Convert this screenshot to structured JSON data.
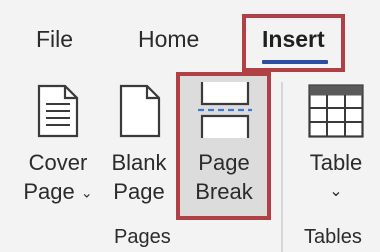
{
  "tabs": {
    "file": "File",
    "home": "Home",
    "insert": "Insert"
  },
  "commands": {
    "cover_page": {
      "line1": "Cover",
      "line2": "Page",
      "chevron": "⌄"
    },
    "blank_page": {
      "line1": "Blank",
      "line2": "Page"
    },
    "page_break": {
      "line1": "Page",
      "line2": "Break"
    },
    "table": {
      "line1": "Table",
      "chevron": "⌄"
    }
  },
  "groups": {
    "pages": "Pages",
    "tables": "Tables"
  },
  "colors": {
    "highlight": "#b13f46",
    "tab_underline": "#2b4ea2",
    "page_break_dashes": "#3a7bd5"
  },
  "icons": {
    "cover_page": "cover-page-icon",
    "blank_page": "blank-page-icon",
    "page_break": "page-break-icon",
    "table": "table-grid-icon"
  }
}
